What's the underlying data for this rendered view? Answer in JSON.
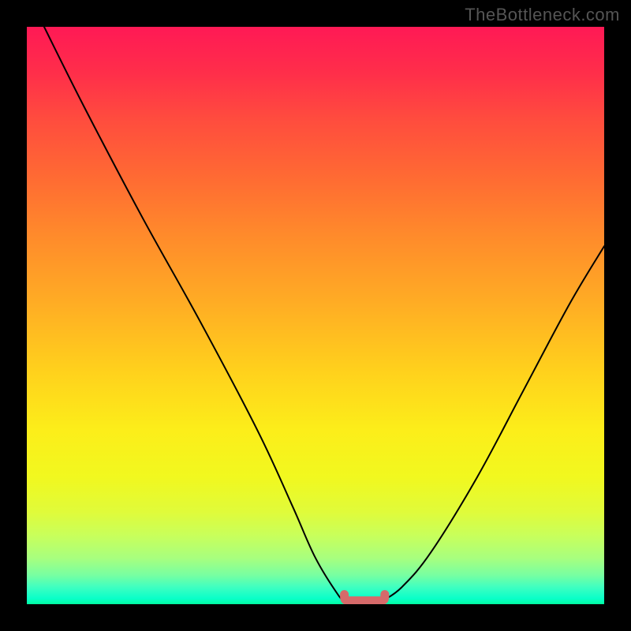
{
  "watermark": "TheBottleneck.com",
  "colors": {
    "frame": "#000000",
    "curve": "#000000",
    "bottom_mark": "#d66a6a",
    "gradient_top": "#ff1955",
    "gradient_bottom": "#00ffa2"
  },
  "chart_data": {
    "type": "line",
    "title": "",
    "xlabel": "",
    "ylabel": "",
    "xlim": [
      0,
      100
    ],
    "ylim": [
      0,
      100
    ],
    "series": [
      {
        "name": "left-branch",
        "x": [
          3,
          10,
          20,
          30,
          40,
          46,
          50,
          54,
          55
        ],
        "values": [
          100,
          86,
          67,
          49,
          30,
          17,
          8,
          1.5,
          0.8
        ]
      },
      {
        "name": "right-branch",
        "x": [
          62,
          65,
          70,
          78,
          86,
          94,
          100
        ],
        "values": [
          0.8,
          3,
          9,
          22,
          37,
          52,
          62
        ]
      },
      {
        "name": "bottom-flat",
        "x": [
          55,
          57,
          60,
          62
        ],
        "values": [
          0.8,
          0.4,
          0.4,
          0.8
        ]
      }
    ],
    "annotations": [
      {
        "name": "bottom-marker",
        "x_range": [
          55,
          62
        ],
        "y": 0.6
      }
    ]
  }
}
